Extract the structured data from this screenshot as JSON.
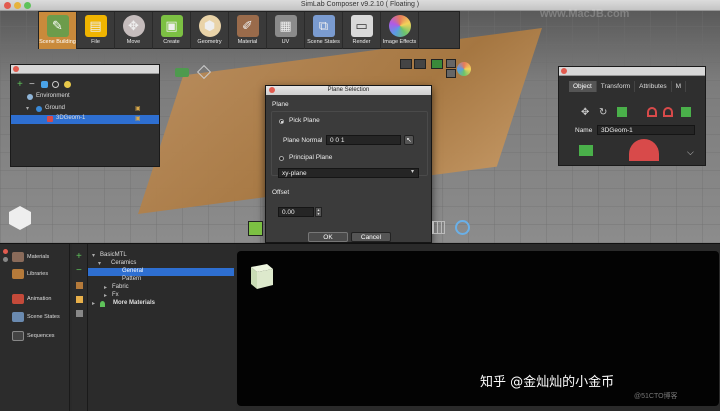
{
  "window": {
    "title": "SimLab Composer v9.2.10 ( Floating )"
  },
  "toolbar": {
    "items": [
      {
        "label": "Scene Building",
        "icon": "scene-building-icon",
        "color": "#6c9c4b",
        "active": true
      },
      {
        "label": "File",
        "icon": "folder-icon",
        "color": "#f0b400",
        "active": false
      },
      {
        "label": "Move",
        "icon": "move-icon",
        "color": "#c5bcbc",
        "active": false
      },
      {
        "label": "Create",
        "icon": "create-icon",
        "color": "#7cc043",
        "active": false
      },
      {
        "label": "Geometry",
        "icon": "geometry-icon",
        "color": "#e9d3a8",
        "active": false
      },
      {
        "label": "Material",
        "icon": "material-icon",
        "color": "#9a6b4b",
        "active": false
      },
      {
        "label": "UV",
        "icon": "uv-icon",
        "color": "#8b8b8b",
        "active": false
      },
      {
        "label": "Scene States",
        "icon": "scene-states-icon",
        "color": "#7a9bd0",
        "active": false
      },
      {
        "label": "Render",
        "icon": "render-icon",
        "color": "#d9d9d9",
        "active": false
      },
      {
        "label": "Image Effects",
        "icon": "image-effects-icon",
        "color": "#e67a5a",
        "active": false
      }
    ]
  },
  "scene_tree": {
    "rows": [
      {
        "label": "Environment"
      },
      {
        "label": "Ground"
      },
      {
        "label": "3DGeom-1"
      }
    ]
  },
  "dialog": {
    "title": "Plane Selection",
    "plane_heading": "Plane",
    "pick_plane_label": "Pick Plane",
    "plane_normal_label": "Plane Normal",
    "plane_normal_value": "0 0 1",
    "principal_plane_label": "Principal Plane",
    "principal_plane_value": "xy-plane",
    "offset_heading": "Offset",
    "offset_value": "0.00",
    "ok_label": "OK",
    "cancel_label": "Cancel"
  },
  "right_panel": {
    "tabs": [
      "Object",
      "Transform",
      "Attributes",
      "M"
    ],
    "name_label": "Name",
    "name_value": "3DGeom-1"
  },
  "sidebar": {
    "items": [
      {
        "label": "Materials",
        "icon": "materials-icon"
      },
      {
        "label": "Libraries",
        "icon": "libraries-icon"
      },
      {
        "label": "Animation",
        "icon": "animation-icon"
      },
      {
        "label": "Scene States",
        "icon": "scene-states-icon"
      },
      {
        "label": "Sequences",
        "icon": "sequences-icon"
      }
    ]
  },
  "library": {
    "rows": [
      {
        "label": "BasicMTL"
      },
      {
        "label": "Ceramics"
      },
      {
        "label": "General"
      },
      {
        "label": "Pattern"
      },
      {
        "label": "Fabric"
      },
      {
        "label": "Fx"
      },
      {
        "label": "More Materials"
      }
    ]
  },
  "watermarks": {
    "top": "www.MacJB.com",
    "zh": "知乎 @金灿灿的小金币",
    "blog": "@51CTO博客"
  }
}
